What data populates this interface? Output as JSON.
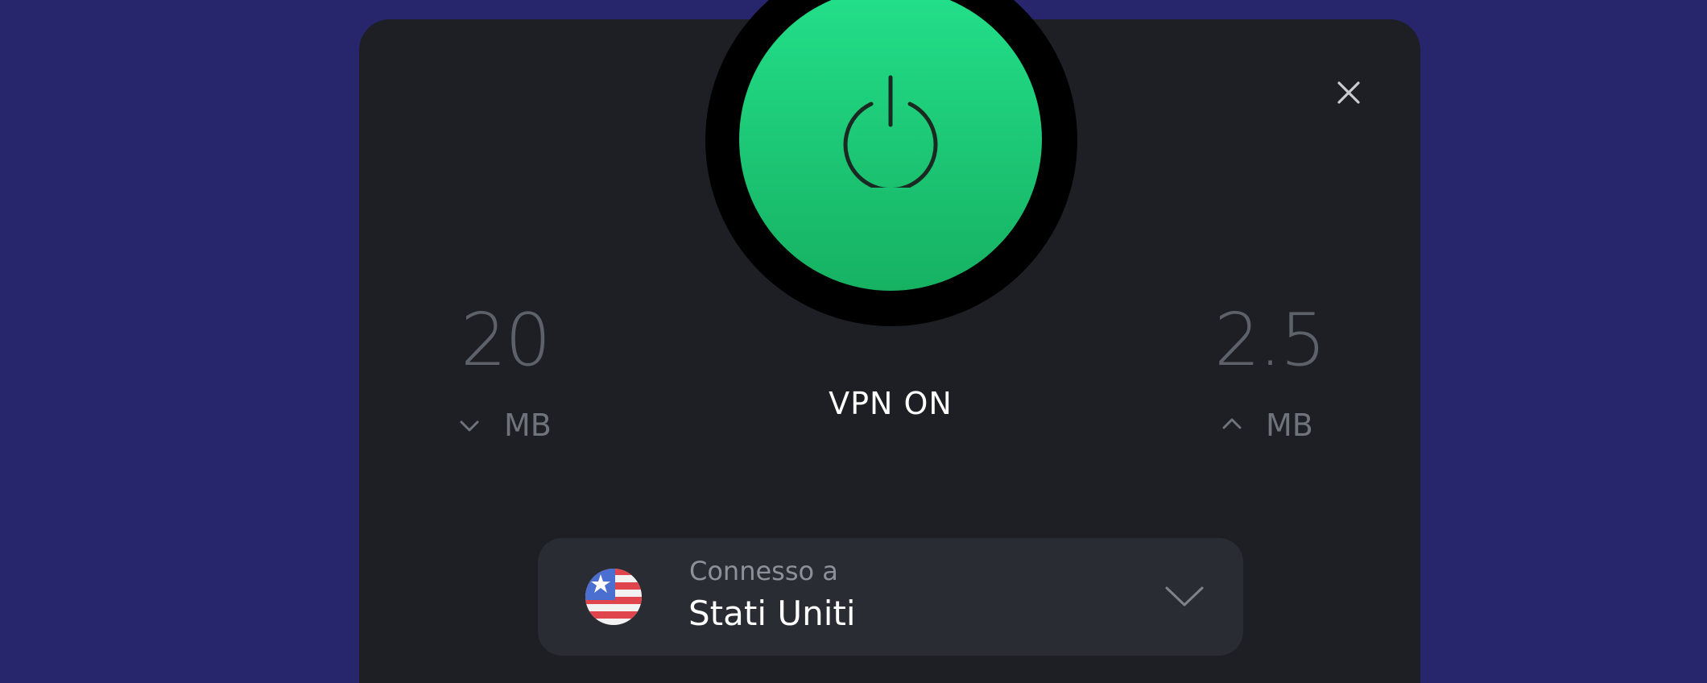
{
  "vpn": {
    "status_label": "VPN ON",
    "connected": true,
    "power_icon": "power-icon"
  },
  "window": {
    "close_icon": "close-icon"
  },
  "stats": {
    "download": {
      "value": "20",
      "unit": "MB",
      "icon": "arrow-down-icon"
    },
    "upload": {
      "value": "2.5",
      "unit": "MB",
      "icon": "arrow-up-icon"
    }
  },
  "location": {
    "caption": "Connesso a",
    "name": "Stati Uniti",
    "flag_icon": "us-flag-icon",
    "dropdown_icon": "chevron-down-icon"
  },
  "colors": {
    "background": "#27256c",
    "panel": "#1e1f24",
    "card": "#2a2c33",
    "accent_green": "#1fcf7b",
    "stat_text": "#5d6169",
    "muted_text": "#8d9098"
  }
}
